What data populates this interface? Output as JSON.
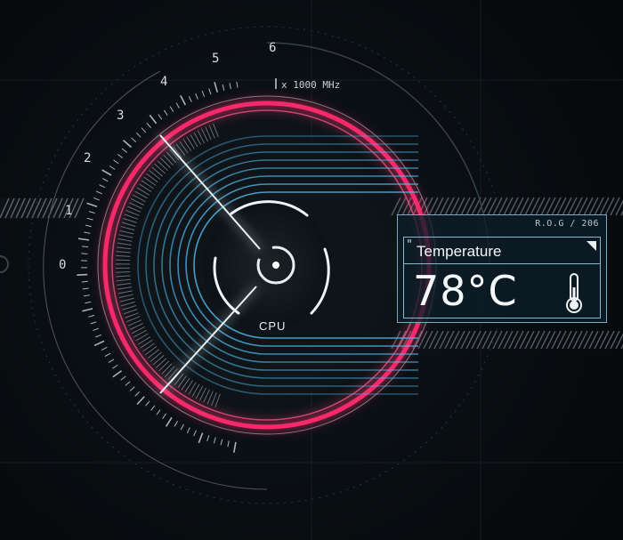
{
  "gauge": {
    "scale_labels": [
      "0",
      "1",
      "2",
      "3",
      "4",
      "5",
      "6"
    ],
    "unit": "x 1000 MHz",
    "center_label": "CPU",
    "colors": {
      "ring": "#ff2a6e",
      "accent": "#4fb4e6",
      "tick": "#c7d0d6"
    }
  },
  "panel": {
    "code": "R.O.G / 206",
    "title": "Temperature",
    "value": "78°C",
    "icons": [
      "quote-mark-icon",
      "corner-triangle-icon",
      "thermometer-icon"
    ]
  }
}
